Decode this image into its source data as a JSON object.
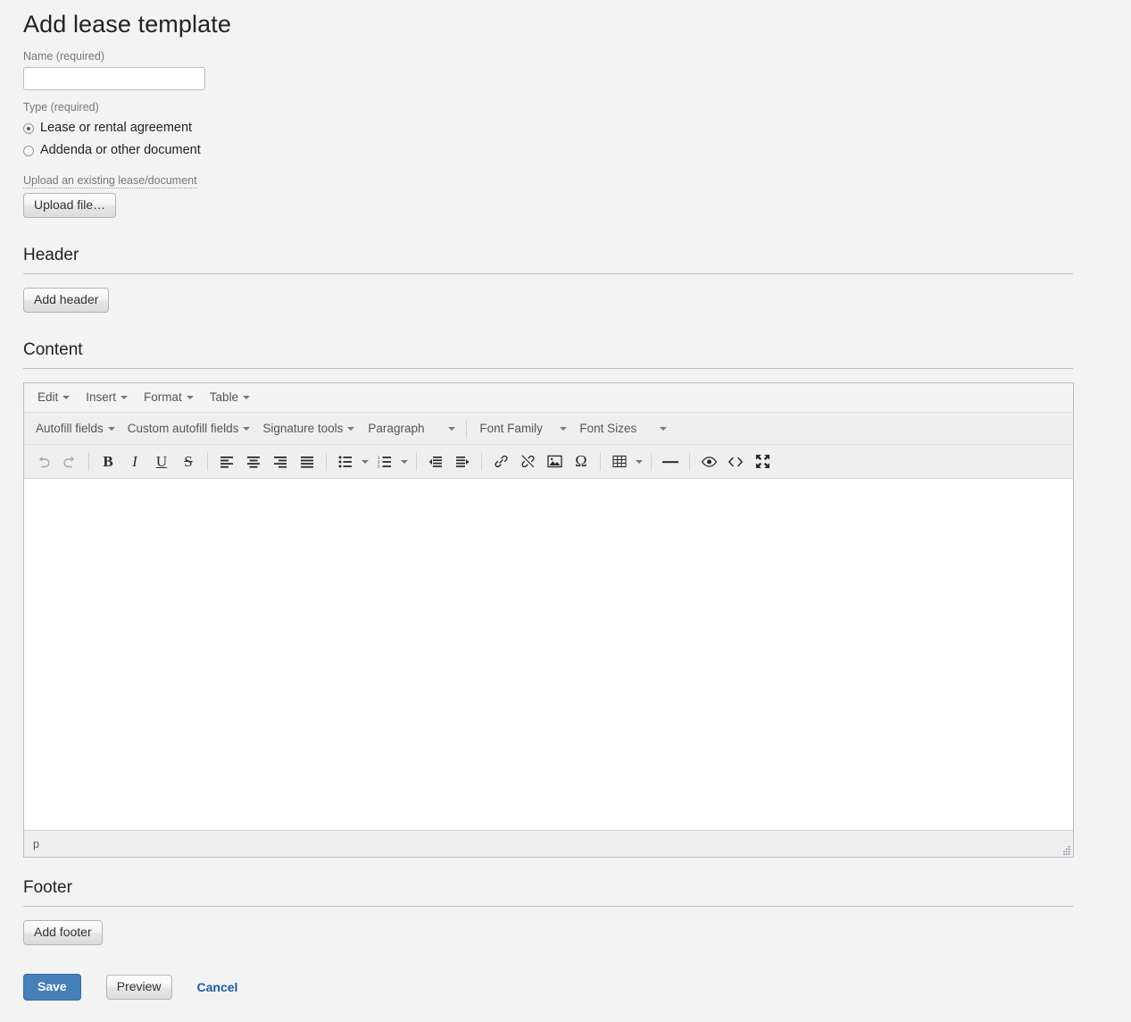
{
  "page": {
    "title": "Add lease template"
  },
  "form": {
    "name": {
      "label": "Name (required)",
      "value": "",
      "placeholder": ""
    },
    "type": {
      "label": "Type (required)",
      "options": [
        {
          "label": "Lease or rental agreement",
          "selected": true
        },
        {
          "label": "Addenda or other document",
          "selected": false
        }
      ]
    },
    "upload": {
      "label": "Upload an existing lease/document",
      "button": "Upload file…"
    }
  },
  "header_section": {
    "title": "Header",
    "add_button": "Add header"
  },
  "content_section": {
    "title": "Content"
  },
  "footer_section": {
    "title": "Footer",
    "add_button": "Add footer"
  },
  "editor": {
    "menubar": [
      {
        "label": "Edit",
        "icon": "chevron-down-icon"
      },
      {
        "label": "Insert",
        "icon": "chevron-down-icon"
      },
      {
        "label": "Format",
        "icon": "chevron-down-icon"
      },
      {
        "label": "Table",
        "icon": "chevron-down-icon"
      }
    ],
    "toolbar_row": {
      "autofill_fields": "Autofill fields",
      "custom_autofill_fields": "Custom autofill fields",
      "signature_tools": "Signature tools",
      "paragraph": "Paragraph",
      "font_family": "Font Family",
      "font_sizes": "Font Sizes"
    },
    "icon_tools": [
      {
        "name": "undo-icon",
        "title": "Undo",
        "disabled": true
      },
      {
        "name": "redo-icon",
        "title": "Redo",
        "disabled": true
      },
      {
        "name": "bold-icon",
        "title": "Bold",
        "glyph": "B"
      },
      {
        "name": "italic-icon",
        "title": "Italic",
        "glyph": "I"
      },
      {
        "name": "underline-icon",
        "title": "Underline",
        "glyph": "U"
      },
      {
        "name": "strikethrough-icon",
        "title": "Strikethrough",
        "glyph": "S"
      },
      {
        "name": "align-left-icon",
        "title": "Align left"
      },
      {
        "name": "align-center-icon",
        "title": "Align center"
      },
      {
        "name": "align-right-icon",
        "title": "Align right"
      },
      {
        "name": "align-justify-icon",
        "title": "Justify"
      },
      {
        "name": "bullet-list-icon",
        "title": "Bullet list"
      },
      {
        "name": "numbered-list-icon",
        "title": "Numbered list"
      },
      {
        "name": "outdent-icon",
        "title": "Decrease indent"
      },
      {
        "name": "indent-icon",
        "title": "Increase indent"
      },
      {
        "name": "link-icon",
        "title": "Insert/edit link"
      },
      {
        "name": "unlink-icon",
        "title": "Remove link"
      },
      {
        "name": "image-icon",
        "title": "Insert/edit image"
      },
      {
        "name": "special-character-icon",
        "title": "Special character",
        "glyph": "Ω"
      },
      {
        "name": "table-icon",
        "title": "Table"
      },
      {
        "name": "horizontal-rule-icon",
        "title": "Horizontal line"
      },
      {
        "name": "preview-icon",
        "title": "Preview"
      },
      {
        "name": "source-code-icon",
        "title": "Source code"
      },
      {
        "name": "fullscreen-icon",
        "title": "Fullscreen"
      }
    ],
    "statusbar": {
      "path": "p"
    }
  },
  "actions": {
    "save": "Save",
    "preview": "Preview",
    "cancel": "Cancel"
  },
  "colors": {
    "page_background": "#f3f3f3",
    "primary_button": "#4580b8",
    "link": "#1f5c9e",
    "toolbar_background": "#efefef",
    "rule": "#bdbdbd"
  }
}
